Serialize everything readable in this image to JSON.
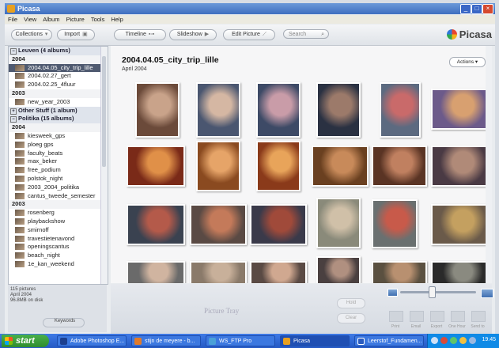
{
  "window": {
    "title": "Picasa"
  },
  "menu": [
    "File",
    "View",
    "Album",
    "Picture",
    "Tools",
    "Help"
  ],
  "toolbar": {
    "collections": "Collections",
    "import": "Import",
    "timeline": "Timeline",
    "slideshow": "Slideshow",
    "edit_picture": "Edit Picture",
    "search": "Search",
    "logo": "Picasa"
  },
  "sidebar": {
    "rows": [
      {
        "kind": "group",
        "label": "Leuven (4 albums)",
        "toggle": "−"
      },
      {
        "kind": "year",
        "label": "2004"
      },
      {
        "kind": "album",
        "label": "2004.04.05_city_trip_lille",
        "selected": true
      },
      {
        "kind": "album",
        "label": "2004.02.27_gert"
      },
      {
        "kind": "album",
        "label": "2004.02.25_4fluur"
      },
      {
        "kind": "year",
        "label": "2003"
      },
      {
        "kind": "album",
        "label": "new_year_2003"
      },
      {
        "kind": "group",
        "label": "Other Stuff (1 album)",
        "toggle": "+"
      },
      {
        "kind": "group",
        "label": "Politika (15 albums)",
        "toggle": "−"
      },
      {
        "kind": "year",
        "label": "2004"
      },
      {
        "kind": "album",
        "label": "kiesweek_gps"
      },
      {
        "kind": "album",
        "label": "ploeg gps"
      },
      {
        "kind": "album",
        "label": "faculty_beats"
      },
      {
        "kind": "album",
        "label": "max_beker"
      },
      {
        "kind": "album",
        "label": "free_podium"
      },
      {
        "kind": "album",
        "label": "polstok_night"
      },
      {
        "kind": "album",
        "label": "2003_2004_politika"
      },
      {
        "kind": "album",
        "label": "cantus_tweede_semester"
      },
      {
        "kind": "year",
        "label": "2003"
      },
      {
        "kind": "album",
        "label": "rosenberg"
      },
      {
        "kind": "album",
        "label": "playbackshow"
      },
      {
        "kind": "album",
        "label": "smirnoff"
      },
      {
        "kind": "album",
        "label": "travestietenavond"
      },
      {
        "kind": "album",
        "label": "openingscantus"
      },
      {
        "kind": "album",
        "label": "beach_night"
      },
      {
        "kind": "album",
        "label": "1e_kan_weekend"
      }
    ],
    "info": {
      "line1": "115 pictures",
      "line2": "April 2004",
      "line3": "96.8MB on disk"
    },
    "keywords": "Keywords"
  },
  "main": {
    "folder_title": "2004.04.05_city_trip_lille",
    "folder_date": "April 2004",
    "actions": "Actions"
  },
  "tray": {
    "label": "Picture Tray",
    "hold": "Hold",
    "clear": "Clear",
    "tools": [
      "Print",
      "Email",
      "Export",
      "One Hour",
      "Send to"
    ]
  },
  "taskbar": {
    "start": "start",
    "tasks": [
      "Adobe Photoshop E...",
      "stijn de meyere - b...",
      "WS_FTP Pro",
      "Picasa",
      "Leerstof_Fundamen..."
    ],
    "clock": "19:45"
  },
  "icons": {
    "app": "picasa-app-icon",
    "minimize": "minimize-icon",
    "maximize": "maximize-icon",
    "close": "close-icon",
    "search": "search-icon"
  },
  "colors": {
    "titlebar": "#3f6fc0",
    "selected_album": "#4f5a70",
    "start_button": "#2f8d2e",
    "taskbar": "#2559c4"
  }
}
